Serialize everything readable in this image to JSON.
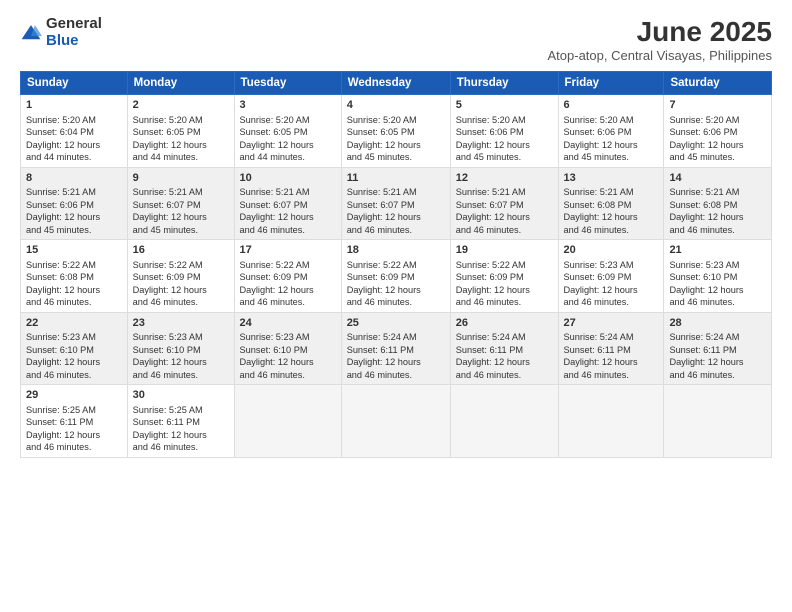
{
  "logo": {
    "general": "General",
    "blue": "Blue"
  },
  "title": "June 2025",
  "subtitle": "Atop-atop, Central Visayas, Philippines",
  "headers": [
    "Sunday",
    "Monday",
    "Tuesday",
    "Wednesday",
    "Thursday",
    "Friday",
    "Saturday"
  ],
  "weeks": [
    [
      {
        "day": "1",
        "sunrise": "5:20 AM",
        "sunset": "6:04 PM",
        "daylight": "12 hours and 44 minutes."
      },
      {
        "day": "2",
        "sunrise": "5:20 AM",
        "sunset": "6:05 PM",
        "daylight": "12 hours and 44 minutes."
      },
      {
        "day": "3",
        "sunrise": "5:20 AM",
        "sunset": "6:05 PM",
        "daylight": "12 hours and 44 minutes."
      },
      {
        "day": "4",
        "sunrise": "5:20 AM",
        "sunset": "6:05 PM",
        "daylight": "12 hours and 45 minutes."
      },
      {
        "day": "5",
        "sunrise": "5:20 AM",
        "sunset": "6:06 PM",
        "daylight": "12 hours and 45 minutes."
      },
      {
        "day": "6",
        "sunrise": "5:20 AM",
        "sunset": "6:06 PM",
        "daylight": "12 hours and 45 minutes."
      },
      {
        "day": "7",
        "sunrise": "5:20 AM",
        "sunset": "6:06 PM",
        "daylight": "12 hours and 45 minutes."
      }
    ],
    [
      {
        "day": "8",
        "sunrise": "5:21 AM",
        "sunset": "6:06 PM",
        "daylight": "12 hours and 45 minutes."
      },
      {
        "day": "9",
        "sunrise": "5:21 AM",
        "sunset": "6:07 PM",
        "daylight": "12 hours and 45 minutes."
      },
      {
        "day": "10",
        "sunrise": "5:21 AM",
        "sunset": "6:07 PM",
        "daylight": "12 hours and 46 minutes."
      },
      {
        "day": "11",
        "sunrise": "5:21 AM",
        "sunset": "6:07 PM",
        "daylight": "12 hours and 46 minutes."
      },
      {
        "day": "12",
        "sunrise": "5:21 AM",
        "sunset": "6:07 PM",
        "daylight": "12 hours and 46 minutes."
      },
      {
        "day": "13",
        "sunrise": "5:21 AM",
        "sunset": "6:08 PM",
        "daylight": "12 hours and 46 minutes."
      },
      {
        "day": "14",
        "sunrise": "5:21 AM",
        "sunset": "6:08 PM",
        "daylight": "12 hours and 46 minutes."
      }
    ],
    [
      {
        "day": "15",
        "sunrise": "5:22 AM",
        "sunset": "6:08 PM",
        "daylight": "12 hours and 46 minutes."
      },
      {
        "day": "16",
        "sunrise": "5:22 AM",
        "sunset": "6:09 PM",
        "daylight": "12 hours and 46 minutes."
      },
      {
        "day": "17",
        "sunrise": "5:22 AM",
        "sunset": "6:09 PM",
        "daylight": "12 hours and 46 minutes."
      },
      {
        "day": "18",
        "sunrise": "5:22 AM",
        "sunset": "6:09 PM",
        "daylight": "12 hours and 46 minutes."
      },
      {
        "day": "19",
        "sunrise": "5:22 AM",
        "sunset": "6:09 PM",
        "daylight": "12 hours and 46 minutes."
      },
      {
        "day": "20",
        "sunrise": "5:23 AM",
        "sunset": "6:09 PM",
        "daylight": "12 hours and 46 minutes."
      },
      {
        "day": "21",
        "sunrise": "5:23 AM",
        "sunset": "6:10 PM",
        "daylight": "12 hours and 46 minutes."
      }
    ],
    [
      {
        "day": "22",
        "sunrise": "5:23 AM",
        "sunset": "6:10 PM",
        "daylight": "12 hours and 46 minutes."
      },
      {
        "day": "23",
        "sunrise": "5:23 AM",
        "sunset": "6:10 PM",
        "daylight": "12 hours and 46 minutes."
      },
      {
        "day": "24",
        "sunrise": "5:23 AM",
        "sunset": "6:10 PM",
        "daylight": "12 hours and 46 minutes."
      },
      {
        "day": "25",
        "sunrise": "5:24 AM",
        "sunset": "6:11 PM",
        "daylight": "12 hours and 46 minutes."
      },
      {
        "day": "26",
        "sunrise": "5:24 AM",
        "sunset": "6:11 PM",
        "daylight": "12 hours and 46 minutes."
      },
      {
        "day": "27",
        "sunrise": "5:24 AM",
        "sunset": "6:11 PM",
        "daylight": "12 hours and 46 minutes."
      },
      {
        "day": "28",
        "sunrise": "5:24 AM",
        "sunset": "6:11 PM",
        "daylight": "12 hours and 46 minutes."
      }
    ],
    [
      {
        "day": "29",
        "sunrise": "5:25 AM",
        "sunset": "6:11 PM",
        "daylight": "12 hours and 46 minutes."
      },
      {
        "day": "30",
        "sunrise": "5:25 AM",
        "sunset": "6:11 PM",
        "daylight": "12 hours and 46 minutes."
      },
      null,
      null,
      null,
      null,
      null
    ]
  ],
  "labels": {
    "sunrise": "Sunrise:",
    "sunset": "Sunset:",
    "daylight": "Daylight:"
  }
}
